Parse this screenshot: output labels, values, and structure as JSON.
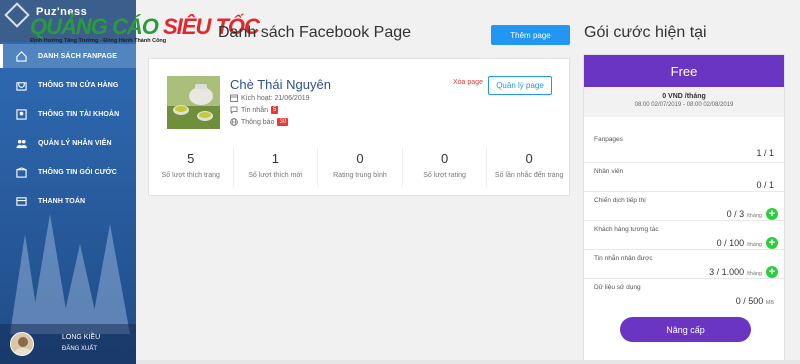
{
  "brand": {
    "logo_text": "Puz'ness",
    "watermark_main": "QUẢNG CÁO ",
    "watermark_accent": "SIÊU TỐC",
    "watermark_sub": "Định Hướng Tăng Trưởng - Đồng Hành Thành Công"
  },
  "sidebar": {
    "items": [
      {
        "label": "Danh sách fanpage",
        "icon": "home-icon",
        "active": true
      },
      {
        "label": "Thông tin cửa hàng",
        "icon": "store-icon"
      },
      {
        "label": "Thông tin tài khoản",
        "icon": "account-icon"
      },
      {
        "label": "Quản lý nhân viên",
        "icon": "users-icon"
      },
      {
        "label": "Thông tin gói cước",
        "icon": "package-icon"
      },
      {
        "label": "Thanh toán",
        "icon": "payment-icon"
      }
    ],
    "user": {
      "name": "LONG KIỀU",
      "logout": "ĐĂNG XUẤT"
    }
  },
  "main": {
    "title": "Danh sách Facebook Page",
    "add_page_label": "Thêm page"
  },
  "page_card": {
    "name": "Chè Thái Nguyên",
    "activated": "Kích hoạt: 21/06/2019",
    "messages_label": "Tin nhắn",
    "messages_count": "5",
    "notifications_label": "Thông báo",
    "notifications_count": "30",
    "delete_label": "Xóa page",
    "manage_label": "Quản lý page",
    "stats": [
      {
        "value": "5",
        "label": "Số lượt thích trang"
      },
      {
        "value": "1",
        "label": "Số lượt thích mới"
      },
      {
        "value": "0",
        "label": "Rating trung bình"
      },
      {
        "value": "0",
        "label": "Số lượt rating"
      },
      {
        "value": "0",
        "label": "Số lần nhắc đến trang"
      }
    ]
  },
  "plan": {
    "title": "Gói cước hiện tại",
    "name": "Free",
    "price": "0 VND /tháng",
    "period": "08:00 02/07/2019 - 08:00 02/08/2019",
    "rows": [
      {
        "key": "Fanpages",
        "value": "1 / 1",
        "unit": "",
        "plus": false
      },
      {
        "key": "Nhân viên",
        "value": "0 / 1",
        "unit": "",
        "plus": false
      },
      {
        "key": "Chiến dịch tiếp thị",
        "value": "0 / 3",
        "unit": "/tháng",
        "plus": true
      },
      {
        "key": "Khách hàng tương tác",
        "value": "0 / 100",
        "unit": "/tháng",
        "plus": true
      },
      {
        "key": "Tin nhắn nhận được",
        "value": "3 / 1.000",
        "unit": "/tháng",
        "plus": true
      },
      {
        "key": "Dữ liệu sử dụng",
        "value": "0 / 500",
        "unit": "MB",
        "plus": false
      }
    ],
    "upgrade_label": "Nâng cấp"
  },
  "colors": {
    "primary": "#2196f3",
    "plan_purple": "#6a35c2",
    "sidebar": "#2f6fb8",
    "plus_green": "#2ecc40",
    "badge_red": "#e53935"
  }
}
